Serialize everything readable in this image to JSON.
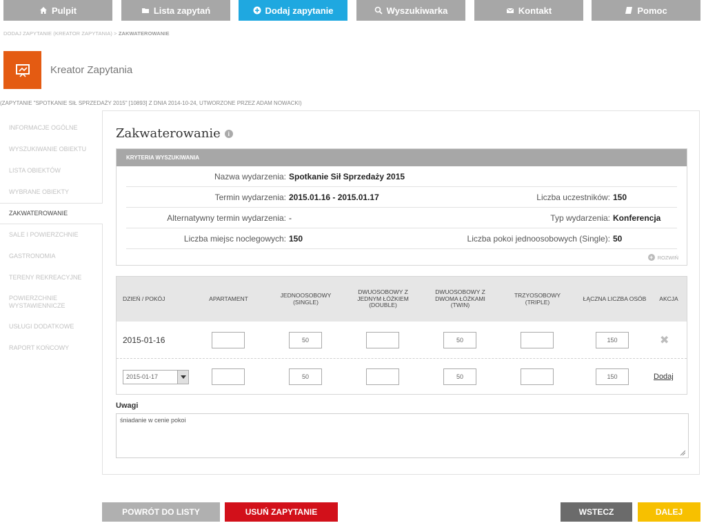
{
  "nav": [
    {
      "label": "Pulpit",
      "icon": "home-icon",
      "active": false
    },
    {
      "label": "Lista zapytań",
      "icon": "folder-icon",
      "active": false
    },
    {
      "label": "Dodaj zapytanie",
      "icon": "plus-circle-icon",
      "active": true
    },
    {
      "label": "Wyszukiwarka",
      "icon": "search-icon",
      "active": false
    },
    {
      "label": "Kontakt",
      "icon": "envelope-icon",
      "active": false
    },
    {
      "label": "Pomoc",
      "icon": "book-icon",
      "active": false
    }
  ],
  "breadcrumb": {
    "path": "DODAJ ZAPYTANIE (KREATOR ZAPYTANIA) >",
    "current": "ZAKWATEROWANIE"
  },
  "header": {
    "title": "Kreator Zapytania",
    "subtitle": "(ZAPYTANIE \"SPOTKANIE SIŁ SPRZEDAŻY 2015\" [10893] Z DNIA 2014-10-24, UTWORZONE PRZEZ ADAM NOWACKI)"
  },
  "sidebar": [
    "INFORMACJE OGÓLNE",
    "WYSZUKIWANIE OBIEKTU",
    "LISTA OBIEKTÓW",
    "WYBRANE OBIEKTY",
    "ZAKWATEROWANIE",
    "SALE I POWIERZCHNIE",
    "GASTRONOMIA",
    "TERENY REKREACYJNE",
    "POWIERZCHNIE WYSTAWIENNICZE",
    "USŁUGI DODATKOWE",
    "RAPORT KOŃCOWY"
  ],
  "main": {
    "title": "Zakwaterowanie",
    "criteria": {
      "header": "KRYTERIA WYSZUKIWANIA",
      "event_name_label": "Nazwa wydarzenia:",
      "event_name": "Spotkanie Sił Sprzedaży 2015",
      "term_label": "Termin wydarzenia:",
      "term": "2015.01.16 - 2015.01.17",
      "participants_label": "Liczba uczestników:",
      "participants": "150",
      "alt_term_label": "Alternatywny termin wydarzenia:",
      "alt_term": "-",
      "type_label": "Typ wydarzenia:",
      "type": "Konferencja",
      "beds_label": "Liczba miejsc noclegowych:",
      "beds": "150",
      "single_label": "Liczba pokoi jednoosobowych (Single):",
      "single": "50",
      "expand": "ROZWIŃ"
    },
    "table": {
      "headers": [
        "DZIEŃ / POKÓJ",
        "APARTAMENT",
        "JEDNOOSOBOWY (SINGLE)",
        "DWUOSOBOWY Z JEDNYM ŁÓŻKIEM (DOUBLE)",
        "DWUOSOBOWY Z DWOMA ŁÓŻKAMI (TWIN)",
        "TRZYOSOBOWY (TRIPLE)",
        "ŁĄCZNA LICZBA OSÓB",
        "AKCJA"
      ],
      "rows": [
        {
          "date": "2015-01-16",
          "apartment": "",
          "single": "50",
          "double": "",
          "twin": "50",
          "triple": "",
          "total": "150",
          "action": "✖"
        }
      ],
      "new_row": {
        "date": "2015-01-17",
        "apartment": "",
        "single": "50",
        "double": "",
        "twin": "50",
        "triple": "",
        "total": "150",
        "action": "Dodaj"
      }
    },
    "notes_label": "Uwagi",
    "notes": "śniadanie w cenie pokoi"
  },
  "buttons": {
    "back": "POWRÓT DO LISTY",
    "delete": "USUŃ ZAPYTANIE",
    "prev": "WSTECZ",
    "next": "DALEJ"
  },
  "colors": {
    "accent_blue": "#1fa8e0",
    "nav_gray": "#a7a7a7",
    "header_orange": "#e45b12",
    "delete_red": "#d2101a",
    "prev_dark": "#6b6b6b",
    "next_yellow": "#f7c000"
  }
}
